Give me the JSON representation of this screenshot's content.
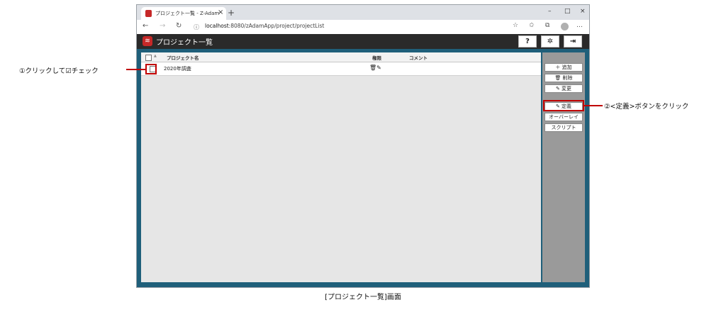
{
  "browser": {
    "tab_title": "プロジェクト一覧 - Z-Adam",
    "tab_close": "×",
    "new_tab": "+",
    "window_controls": [
      "–",
      "□",
      "×"
    ],
    "nav": {
      "back": "←",
      "forward": "→",
      "reload": "↻"
    },
    "address_info_icon": "ⓘ",
    "address_host": "localhost",
    "address_path": ":8080/zAdamApp/project/projectList",
    "toolbar_icons": [
      "☆",
      "✩",
      "⧉",
      "…"
    ]
  },
  "app": {
    "logo": "≋",
    "title": "プロジェクト一覧",
    "header_buttons": {
      "help": "?",
      "settings": "✲",
      "logout": "⇥"
    }
  },
  "table": {
    "sort_indicator": "▲",
    "columns": {
      "name": "プロジェクト名",
      "permission": "権限",
      "comment": "コメント"
    },
    "rows": [
      {
        "name": "2020年調査",
        "permission_icons": "🗑✎",
        "comment": ""
      }
    ]
  },
  "sidebar": {
    "add": "＋ 追加",
    "delete": "🗑 削除",
    "edit": "✎ 変更",
    "define": "✎ 定義",
    "overlay": "オーバーレイ",
    "script": "スクリプト"
  },
  "annotations": {
    "step1": "①クリックして☑チェック",
    "step2": "②<定義>ボタンをクリック",
    "caption": "[プロジェクト一覧]画面",
    "highlight_color": "#c00000"
  }
}
